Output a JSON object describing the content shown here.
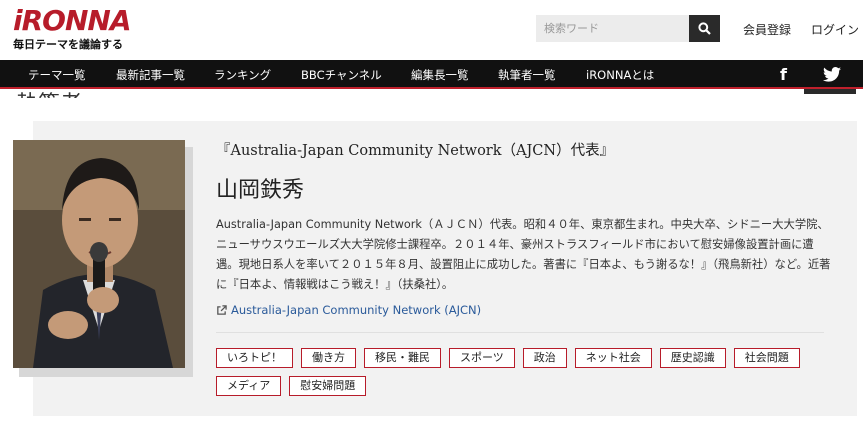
{
  "header": {
    "logo_text": "iRONNA",
    "tagline": "毎日テーマを議論する",
    "search_placeholder": "検索ワード",
    "register_label": "会員登録",
    "login_label": "ログイン"
  },
  "nav": {
    "items": [
      "テーマ一覧",
      "最新記事一覧",
      "ランキング",
      "BBCチャンネル",
      "編集長一覧",
      "執筆者一覧",
      "iRONNAとは"
    ],
    "facebook_glyph": "f",
    "twitter_glyph": "🐦"
  },
  "background": {
    "partial_heading": "執筆者"
  },
  "profile": {
    "affiliation": "『Australia-Japan Community Network（AJCN）代表』",
    "name": "山岡鉄秀",
    "bio": "Australia-Japan Community Network（ＡＪＣＮ）代表。昭和４０年、東京都生まれ。中央大卒、シドニー大大学院、ニューサウスウエールズ大大学院修士課程卒。２０１４年、豪州ストラスフィールド市において慰安婦像設置計画に遭遇。現地日系人を率いて２０１５年８月、設置阻止に成功した。著書に『日本よ、もう謝るな！』（飛鳥新社）など。近著に『日本よ、情報戦はこう戦え！』（扶桑社）。",
    "link_label": "Australia-Japan Community Network (AJCN)",
    "tags": [
      "いろトピ！",
      "働き方",
      "移民・難民",
      "スポーツ",
      "政治",
      "ネット社会",
      "歴史認識",
      "社会問題",
      "メディア",
      "慰安婦問題"
    ]
  },
  "colors": {
    "brand": "#b71c2a",
    "nav_bg": "#111111",
    "link": "#2a5a9a"
  }
}
